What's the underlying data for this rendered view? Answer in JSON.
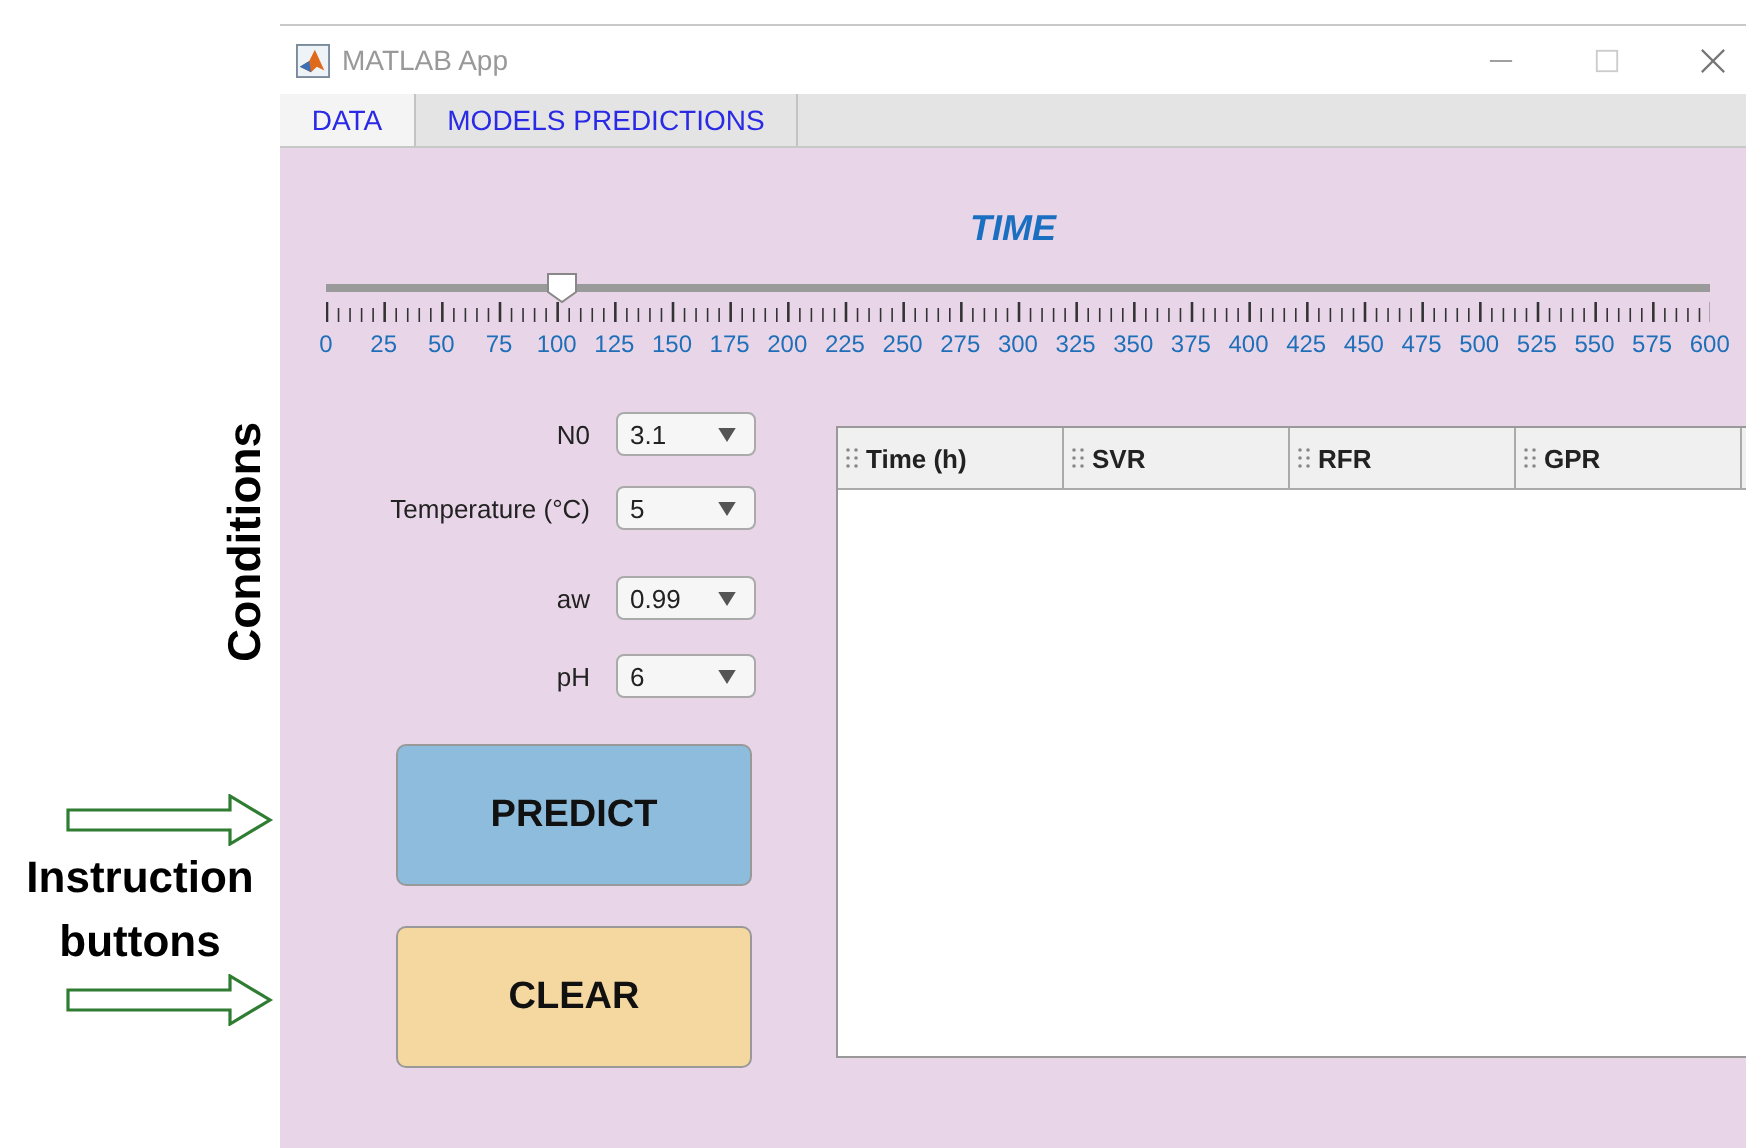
{
  "window": {
    "title": "MATLAB App"
  },
  "tabs": [
    {
      "label": "DATA",
      "selected": true
    },
    {
      "label": "MODELS PREDICTIONS",
      "selected": false
    }
  ],
  "slider": {
    "title": "TIME",
    "level": 0.1667,
    "tick_labels": [
      "0",
      "25",
      "50",
      "75",
      "100",
      "125",
      "150",
      "175",
      "200",
      "225",
      "250",
      "275",
      "300",
      "325",
      "350",
      "375",
      "400",
      "425",
      "450",
      "475",
      "500",
      "525",
      "550",
      "575",
      "600"
    ]
  },
  "conditions": [
    {
      "label": "N0",
      "value": "3.1"
    },
    {
      "label": "Temperature (°C)",
      "value": "5"
    },
    {
      "label": "aw",
      "value": "0.99"
    },
    {
      "label": "pH",
      "value": "6"
    }
  ],
  "buttons": [
    {
      "label": "PREDICT",
      "kind": "predict"
    },
    {
      "label": "CLEAR",
      "kind": "clear"
    }
  ],
  "table": {
    "columns": [
      "Time (h)",
      "SVR",
      "RFR",
      "GPR"
    ]
  },
  "annotations": {
    "conditions_label": "Conditions",
    "buttons_label": "Instruction buttons"
  }
}
